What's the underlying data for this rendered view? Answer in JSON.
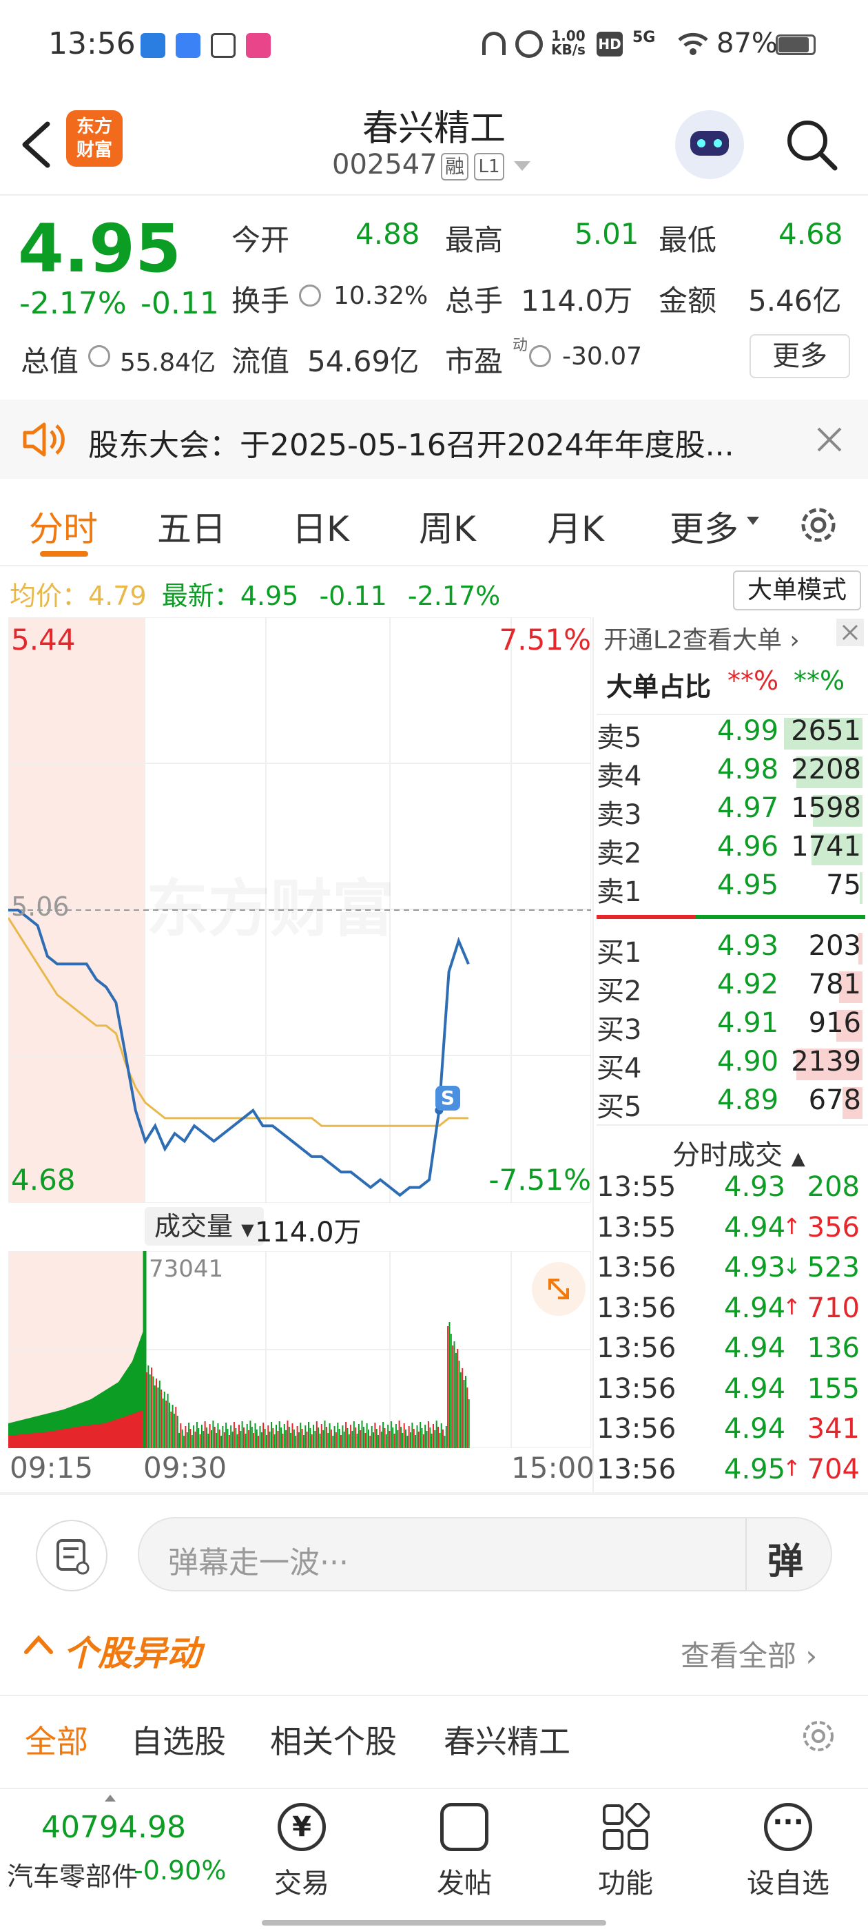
{
  "status_bar": {
    "time": "13:56",
    "net_speed_top": "1.00",
    "net_speed_bottom": "KB/s",
    "signal": "5G",
    "battery": "87%"
  },
  "header": {
    "logo_line1": "东方",
    "logo_line2": "财富",
    "stock_name": "春兴精工",
    "stock_code": "002547",
    "badge_rong": "融",
    "badge_level": "L1"
  },
  "quote": {
    "price": "4.95",
    "change_pct": "-2.17%",
    "change_abs": "-0.11",
    "open_label": "今开",
    "open": "4.88",
    "high_label": "最高",
    "high": "5.01",
    "low_label": "最低",
    "low": "4.68",
    "turnover_label": "换手",
    "turnover": "10.32%",
    "volume_label": "总手",
    "volume": "114.0万",
    "amount_label": "金额",
    "amount": "5.46亿",
    "mktcap_label": "总值",
    "mktcap": "55.84亿",
    "float_label": "流值",
    "float_cap": "54.69亿",
    "pe_label": "市盈",
    "pe_sup": "动",
    "pe": "-30.07",
    "more_button": "更多"
  },
  "notice": {
    "text": "股东大会：于2025-05-16召开2024年年度股..."
  },
  "tabs": [
    "分时",
    "五日",
    "日K",
    "周K",
    "月K",
    "更多"
  ],
  "chart_info": {
    "avg_label": "均价：",
    "avg": "4.79",
    "latest_label": "最新：",
    "latest": "4.95",
    "latest_chg": "-0.11",
    "latest_pct": "-2.17%",
    "big_order_button": "大单模式"
  },
  "chart_data": {
    "type": "line",
    "y_max": "5.44",
    "y_max_pct": "7.51%",
    "y_min": "4.68",
    "y_min_pct": "-7.51%",
    "prev_close": "5.06",
    "ylim": [
      4.68,
      5.44
    ],
    "price_series": [
      5.06,
      5.06,
      5.05,
      5.04,
      5.0,
      4.99,
      4.99,
      4.99,
      4.99,
      4.97,
      4.96,
      4.94,
      4.87,
      4.8,
      4.76,
      4.78,
      4.75,
      4.77,
      4.76,
      4.78,
      4.77,
      4.76,
      4.77,
      4.78,
      4.79,
      4.8,
      4.78,
      4.78,
      4.77,
      4.76,
      4.75,
      4.74,
      4.74,
      4.73,
      4.72,
      4.72,
      4.71,
      4.7,
      4.71,
      4.7,
      4.69,
      4.7,
      4.7,
      4.71,
      4.8,
      4.98,
      5.02,
      4.99
    ],
    "avg_series": [
      5.05,
      5.03,
      5.01,
      4.99,
      4.97,
      4.95,
      4.94,
      4.93,
      4.92,
      4.91,
      4.91,
      4.9,
      4.86,
      4.83,
      4.81,
      4.8,
      4.79,
      4.79,
      4.79,
      4.79,
      4.79,
      4.79,
      4.79,
      4.79,
      4.79,
      4.79,
      4.79,
      4.79,
      4.79,
      4.79,
      4.79,
      4.79,
      4.78,
      4.78,
      4.78,
      4.78,
      4.78,
      4.78,
      4.78,
      4.78,
      4.78,
      4.78,
      4.78,
      4.78,
      4.78,
      4.79,
      4.79,
      4.79
    ],
    "volume_label": "成交量",
    "volume_total": "114.0万",
    "volume_peak": "73041",
    "x_ticks": [
      "09:15",
      "09:30",
      "15:00"
    ],
    "trade_marker": "S",
    "watermark": "东方财富"
  },
  "order_book": {
    "l2_link": "开通L2查看大单",
    "ratio_label": "大单占比",
    "ratio_sell": "**%",
    "ratio_buy": "**%",
    "asks": [
      {
        "name": "卖5",
        "price": "4.99",
        "vol": "2651",
        "fill": 0.95
      },
      {
        "name": "卖4",
        "price": "4.98",
        "vol": "2208",
        "fill": 0.8
      },
      {
        "name": "卖3",
        "price": "4.97",
        "vol": "1598",
        "fill": 0.6
      },
      {
        "name": "卖2",
        "price": "4.96",
        "vol": "1741",
        "fill": 0.62
      },
      {
        "name": "卖1",
        "price": "4.95",
        "vol": "75",
        "fill": 0.03
      }
    ],
    "bids": [
      {
        "name": "买1",
        "price": "4.93",
        "vol": "203",
        "fill": 0.05
      },
      {
        "name": "买2",
        "price": "4.92",
        "vol": "781",
        "fill": 0.28
      },
      {
        "name": "买3",
        "price": "4.91",
        "vol": "916",
        "fill": 0.32
      },
      {
        "name": "买4",
        "price": "4.90",
        "vol": "2139",
        "fill": 0.8
      },
      {
        "name": "买5",
        "price": "4.89",
        "vol": "678",
        "fill": 0.24
      }
    ]
  },
  "trades": {
    "title": "分时成交",
    "rows": [
      {
        "time": "13:55",
        "price": "4.93",
        "arrow": "",
        "vol": "208",
        "side": "buy"
      },
      {
        "time": "13:55",
        "price": "4.94",
        "arrow": "↑",
        "vol": "356",
        "side": "sell"
      },
      {
        "time": "13:56",
        "price": "4.93",
        "arrow": "↓",
        "vol": "523",
        "side": "buy"
      },
      {
        "time": "13:56",
        "price": "4.94",
        "arrow": "↑",
        "vol": "710",
        "side": "sell"
      },
      {
        "time": "13:56",
        "price": "4.94",
        "arrow": "",
        "vol": "136",
        "side": "buy"
      },
      {
        "time": "13:56",
        "price": "4.94",
        "arrow": "",
        "vol": "155",
        "side": "buy"
      },
      {
        "time": "13:56",
        "price": "4.94",
        "arrow": "",
        "vol": "341",
        "side": "sell"
      },
      {
        "time": "13:56",
        "price": "4.95",
        "arrow": "↑",
        "vol": "704",
        "side": "sell"
      }
    ]
  },
  "comment": {
    "placeholder": "弹幕走一波···",
    "danmu_button": "弹"
  },
  "movement": {
    "title": "个股异动",
    "view_all": "查看全部",
    "filters": [
      "全部",
      "自选股",
      "相关个股",
      "春兴精工"
    ]
  },
  "bottom_bar": {
    "index_value": "40794.98",
    "index_name": "汽车零部件",
    "index_change": "-0.90%",
    "nav": [
      "交易",
      "发帖",
      "功能",
      "设自选"
    ]
  },
  "colors": {
    "up": "#e5262b",
    "down": "#0c9d24",
    "accent": "#f07a10",
    "price_line": "#2e6db4",
    "avg_line": "#e8b84b"
  }
}
